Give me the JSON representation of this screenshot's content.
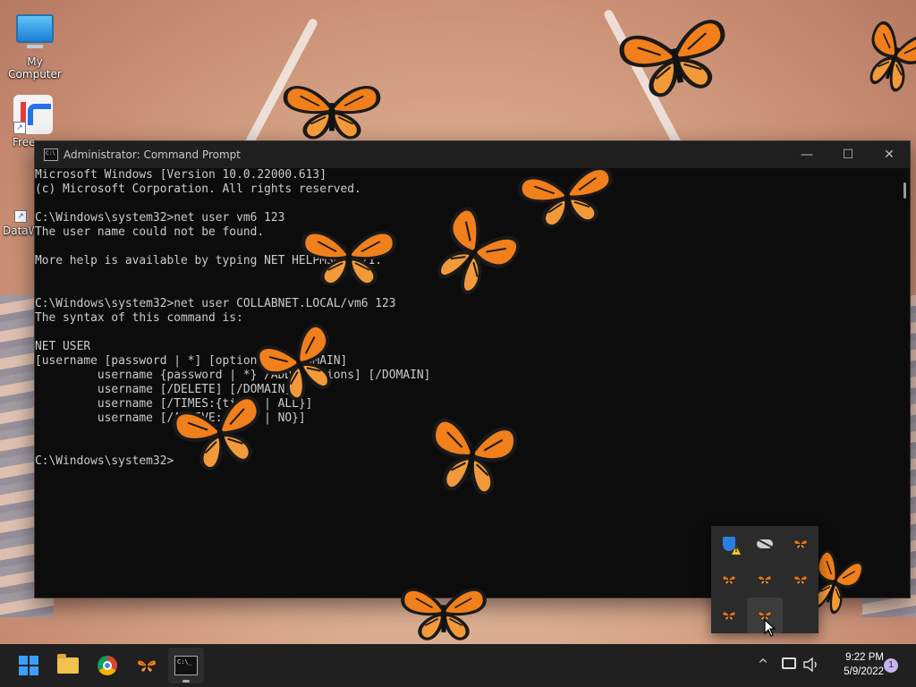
{
  "desktop": {
    "icons": [
      {
        "label": "My Computer"
      },
      {
        "label": "Free"
      },
      {
        "label": "DataW"
      }
    ]
  },
  "cmd_window": {
    "title": "Administrator: Command Prompt",
    "minimize_symbol": "—",
    "maximize_symbol": "☐",
    "close_symbol": "✕",
    "lines": [
      "Microsoft Windows [Version 10.0.22000.613]",
      "(c) Microsoft Corporation. All rights reserved.",
      "",
      "C:\\Windows\\system32>net user vm6 123",
      "The user name could not be found.",
      "",
      "More help is available by typing NET HELPMSG 2221.",
      "",
      "",
      "C:\\Windows\\system32>net user COLLABNET.LOCAL/vm6 123",
      "The syntax of this command is:",
      "",
      "NET USER",
      "[username [password | *] [options]] [/DOMAIN]",
      "         username {password | *} /ADD [options] [/DOMAIN]",
      "         username [/DELETE] [/DOMAIN]",
      "         username [/TIMES:{times | ALL}]",
      "         username [/ACTIVE: {YES | NO}]",
      "",
      "",
      "C:\\Windows\\system32>"
    ]
  },
  "tray_flyout": {
    "icons": [
      "shield-warning-icon",
      "cloud-off-icon",
      "butterfly-icon",
      "butterfly-icon",
      "butterfly-icon",
      "butterfly-icon",
      "butterfly-icon",
      "butterfly-icon"
    ]
  },
  "taskbar": {
    "apps": [
      "start-icon",
      "file-explorer-icon",
      "chrome-icon",
      "butterfly-app-icon",
      "command-prompt-icon"
    ],
    "chevron_symbol": "^",
    "time": "9:22 PM",
    "date": "5/9/2022",
    "notification_count": "1"
  },
  "colors": {
    "butterfly_orange": "#f07f1c",
    "console_bg": "#0c0c0c",
    "console_text": "#cccccc",
    "taskbar_bg": "#202020"
  }
}
